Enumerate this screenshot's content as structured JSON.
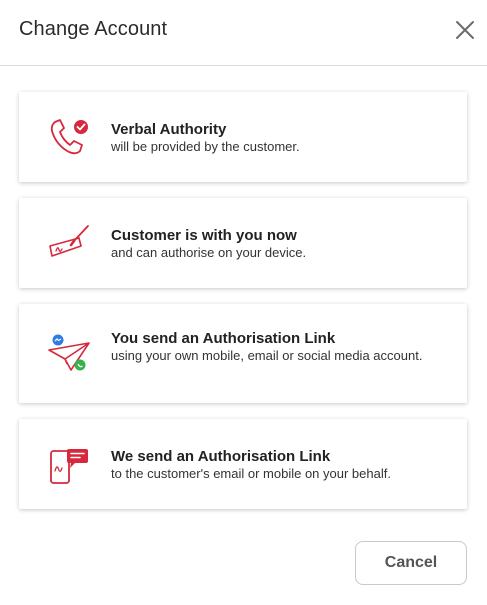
{
  "dialog": {
    "title": "Change Account",
    "close_icon": "close-icon"
  },
  "options": [
    {
      "title": "Verbal Authority",
      "subtitle": "will be provided by the customer.",
      "icon": "phone-check-icon"
    },
    {
      "title": "Customer is with you now",
      "subtitle": "and can authorise on your device.",
      "icon": "pen-signature-icon"
    },
    {
      "title": "You send an Authorisation Link",
      "subtitle": "using your own mobile, email or social media account.",
      "icon": "paper-plane-icon"
    },
    {
      "title": "We send an Authorisation Link",
      "subtitle": "to the customer's email or mobile on your behalf.",
      "icon": "mobile-message-icon"
    }
  ],
  "footer": {
    "cancel_label": "Cancel"
  },
  "colors": {
    "accent": "#d6293e",
    "messenger": "#2f7de1",
    "whatsapp": "#35b34a"
  }
}
